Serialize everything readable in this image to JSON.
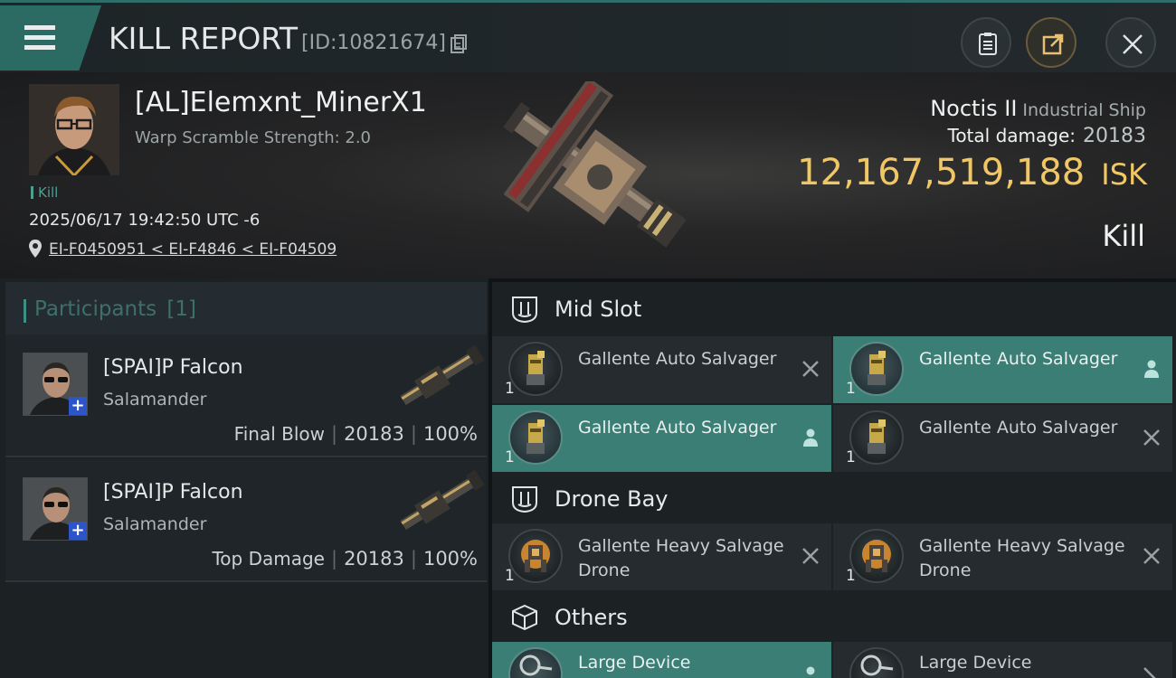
{
  "topbar": {
    "title": "KILL REPORT",
    "report_id": "[ID:10821674]"
  },
  "victim": {
    "name": "[AL]Elemxnt_MinerX1",
    "warp_scramble": "Warp Scramble Strength: 2.0",
    "tag": "Kill",
    "datetime": "2025/06/17 19:42:50 UTC -6",
    "location": "EI-F0450951 < EI-F4846 < EI-F04509"
  },
  "ship": {
    "name": "Noctis II",
    "class": "Industrial Ship",
    "total_damage_label": "Total damage:",
    "total_damage": "20183",
    "isk_value": "12,167,519,188",
    "isk_unit": "ISK",
    "result": "Kill"
  },
  "participants": {
    "title": "Participants",
    "count": "[1]",
    "rows": [
      {
        "name": "[SPAI]P Falcon",
        "ship": "Salamander",
        "role": "Final Blow",
        "damage": "20183",
        "percent": "100%"
      },
      {
        "name": "[SPAI]P Falcon",
        "ship": "Salamander",
        "role": "Top Damage",
        "damage": "20183",
        "percent": "100%"
      }
    ]
  },
  "fitting": {
    "mid_slot": {
      "title": "Mid Slot",
      "items": [
        {
          "qty": "1",
          "name": "Gallente Auto Salvager",
          "state": "destroyed"
        },
        {
          "qty": "1",
          "name": "Gallente Auto Salvager",
          "state": "dropped"
        },
        {
          "qty": "1",
          "name": "Gallente Auto Salvager",
          "state": "dropped"
        },
        {
          "qty": "1",
          "name": "Gallente Auto Salvager",
          "state": "destroyed"
        }
      ]
    },
    "drone_bay": {
      "title": "Drone Bay",
      "items": [
        {
          "qty": "1",
          "name": "Gallente Heavy Salvage Drone",
          "state": "destroyed"
        },
        {
          "qty": "1",
          "name": "Gallente Heavy Salvage Drone",
          "state": "destroyed"
        }
      ]
    },
    "others": {
      "title": "Others",
      "items": [
        {
          "qty": "",
          "name": "Large Device",
          "state": "dropped"
        },
        {
          "qty": "",
          "name": "Large Device",
          "state": "destroyed"
        }
      ]
    }
  },
  "colors": {
    "accent": "#3a7e75",
    "isk": "#f0c764",
    "panel": "#1c2124"
  }
}
